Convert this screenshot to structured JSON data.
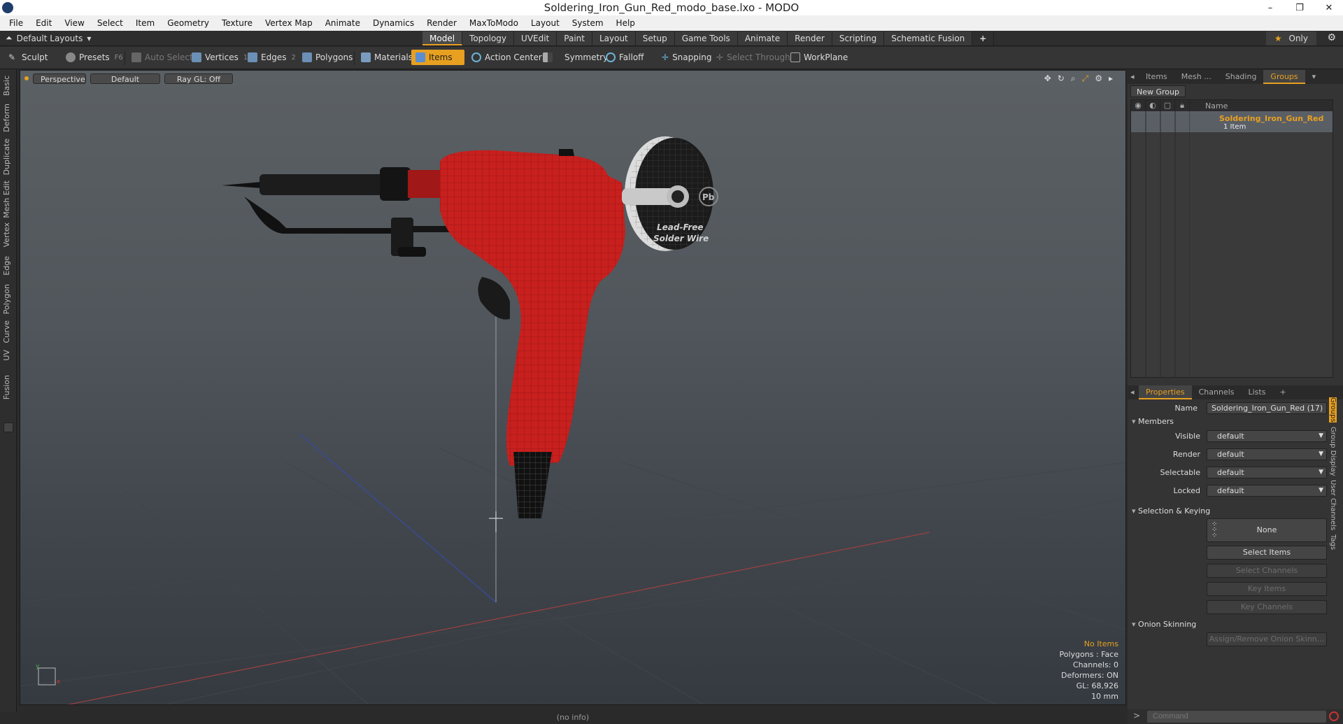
{
  "window": {
    "title": "Soldering_Iron_Gun_Red_modo_base.lxo - MODO",
    "buttons": [
      "–",
      "❐",
      "✕"
    ]
  },
  "menu": [
    "File",
    "Edit",
    "View",
    "Select",
    "Item",
    "Geometry",
    "Texture",
    "Vertex Map",
    "Animate",
    "Dynamics",
    "Render",
    "MaxToModo",
    "Layout",
    "System",
    "Help"
  ],
  "layoutbar": {
    "layout_label": "Default Layouts",
    "tabs": [
      "Model",
      "Topology",
      "UVEdit",
      "Paint",
      "Layout",
      "Setup",
      "Game Tools",
      "Animate",
      "Render",
      "Scripting",
      "Schematic Fusion"
    ],
    "active_tab": "Model",
    "plus": "+",
    "only_label": "Only"
  },
  "toolbar": {
    "sculpt": "Sculpt",
    "presets": "Presets",
    "presets_key": "F6",
    "auto_select": "Auto Select",
    "vertices": "Vertices",
    "vertices_count": "1",
    "edges": "Edges",
    "edges_count": "2",
    "polygons": "Polygons",
    "materials": "Materials",
    "items": "Items",
    "action_center": "Action Center",
    "symmetry": "Symmetry",
    "falloff": "Falloff",
    "snapping": "Snapping",
    "select_through": "Select Through",
    "workplane": "WorkPlane"
  },
  "left_tabs": [
    "Basic",
    "Deform",
    "Duplicate",
    "Mesh Edit",
    "Vertex",
    "Edge",
    "Polygon",
    "Curve",
    "UV",
    "Fusion"
  ],
  "viewport": {
    "view": "Perspective",
    "shading": "Default",
    "raygl": "Ray GL: Off",
    "info": {
      "items": "No Items",
      "polygons": "Polygons : Face",
      "channels": "Channels: 0",
      "deformers": "Deformers: ON",
      "gl": "GL: 68,926",
      "units": "10 mm"
    },
    "spool_text_1": "Lead-Free",
    "spool_text_2": "Solder Wire",
    "spool_badge": "Pb",
    "axis_y": "y",
    "axis_x": "x"
  },
  "status": "(no info)",
  "groups_panel": {
    "tabs": [
      "Items",
      "Mesh ...",
      "Shading",
      "Groups"
    ],
    "active_tab": "Groups",
    "new_group": "New Group",
    "col_name": "Name",
    "row_name": "Soldering_Iron_Gun_Red",
    "row_sub": "1 Item"
  },
  "properties_panel": {
    "tabs": [
      "Properties",
      "Channels",
      "Lists"
    ],
    "plus": "+",
    "name_label": "Name",
    "name_value": "Soldering_Iron_Gun_Red (17)",
    "members": "Members",
    "visible_label": "Visible",
    "render_label": "Render",
    "selectable_label": "Selectable",
    "locked_label": "Locked",
    "default_value": "default",
    "selection_keying": "Selection & Keying",
    "none": "None",
    "select_items": "Select Items",
    "select_channels": "Select Channels",
    "key_items": "Key Items",
    "key_channels": "Key Channels",
    "onion": "Onion Skinning",
    "assign_onion": "Assign/Remove Onion Skinn..."
  },
  "side_vtabs": [
    "Groups",
    "Group Display",
    "User Channels",
    "Tags"
  ],
  "command_placeholder": "Command",
  "colors": {
    "accent": "#e8a020",
    "gun_red": "#c8201e",
    "viewport_top": "#5b6064"
  }
}
